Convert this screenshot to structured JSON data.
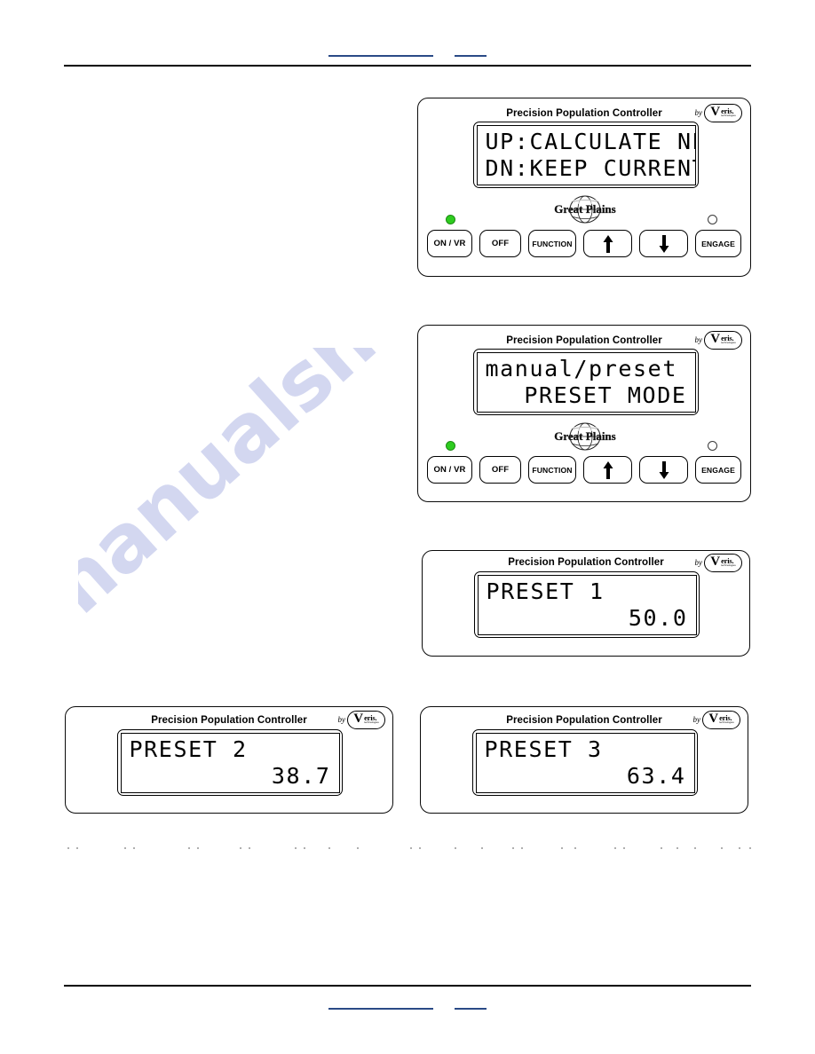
{
  "document": {
    "header_links": [
      "",
      ""
    ],
    "footer_links": [
      "",
      ""
    ],
    "watermark": "manualshive.com"
  },
  "panel_common": {
    "title": "Precision Population Controller",
    "brand_by": "by",
    "brand_mark": "V",
    "brand_name": "eris.",
    "brand_tagline": "technologies",
    "oem_logo": "Great Plains",
    "led_on_name": "power-led-on",
    "led_off_name": "engage-led-off",
    "buttons": [
      {
        "label": "ON / VR",
        "name": "on-vr-button",
        "kind": "text"
      },
      {
        "label": "OFF",
        "name": "off-button",
        "kind": "text"
      },
      {
        "label": "FUNCTION",
        "name": "function-button",
        "kind": "text"
      },
      {
        "label": "↑",
        "name": "up-arrow-button",
        "kind": "arrow-up"
      },
      {
        "label": "↓",
        "name": "down-arrow-button",
        "kind": "arrow-down"
      },
      {
        "label": "ENGAGE",
        "name": "engage-button",
        "kind": "text"
      }
    ]
  },
  "panels": [
    {
      "id": "panel-calculate-new",
      "variant": "full",
      "lcd": {
        "line1": "UP:CALCULATE NEW",
        "line2": "DN:KEEP CURRENT",
        "line1_align": "left",
        "line2_align": "left"
      }
    },
    {
      "id": "panel-preset-mode",
      "variant": "full",
      "lcd": {
        "line1": "manual/preset",
        "line2": "PRESET MODE",
        "line1_align": "left",
        "line2_align": "right"
      }
    },
    {
      "id": "panel-preset-1",
      "variant": "compact",
      "lcd": {
        "line1": "PRESET 1",
        "line2": "50.0",
        "line1_align": "left",
        "line2_align": "right"
      }
    },
    {
      "id": "panel-preset-2",
      "variant": "compact",
      "lcd": {
        "line1": "PRESET 2",
        "line2": "38.7",
        "line1_align": "left",
        "line2_align": "right"
      }
    },
    {
      "id": "panel-preset-3",
      "variant": "compact",
      "lcd": {
        "line1": "PRESET 3",
        "line2": "63.4",
        "line1_align": "left",
        "line2_align": "right"
      }
    }
  ],
  "colors": {
    "led_on": "#2ecc1f",
    "link_underline": "#2a4a86",
    "watermark": "#b9c0e8",
    "ink": "#000000"
  }
}
